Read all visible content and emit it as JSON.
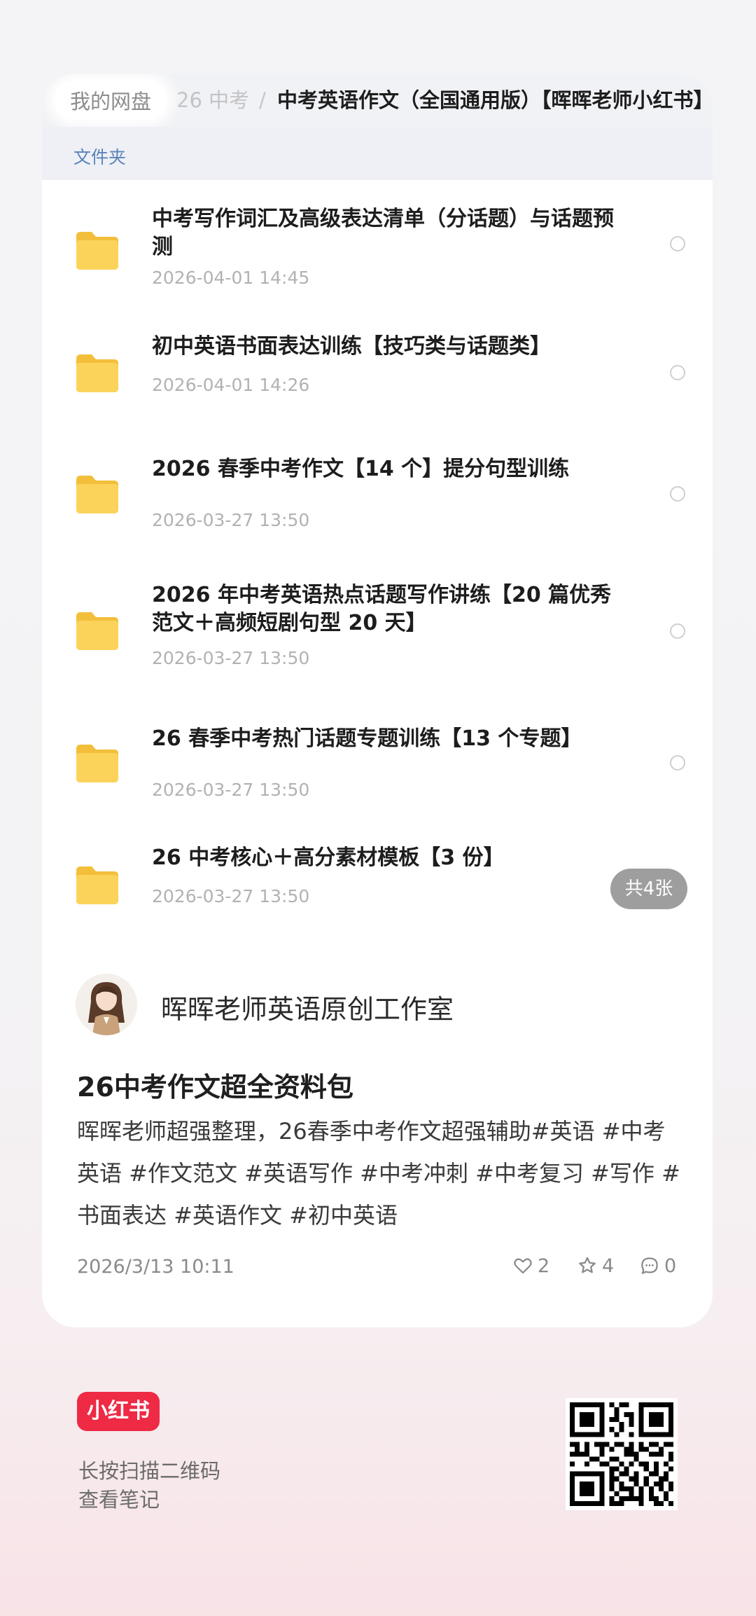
{
  "breadcrumb": {
    "root": "我的网盘",
    "level2": "26 中考",
    "separator": "/",
    "current": "中考英语作文（全国通用版）【晖晖老师小红书】"
  },
  "folder_header": "文件夹",
  "folders": [
    {
      "title": "中考写作词汇及高级表达清单（分话题）与话题预测",
      "date": "2026-04-01 14:45"
    },
    {
      "title": "初中英语书面表达训练【技巧类与话题类】",
      "date": "2026-04-01 14:26"
    },
    {
      "title": "2026 春季中考作文【14 个】提分句型训练",
      "date": "2026-03-27 13:50"
    },
    {
      "title": "2026 年中考英语热点话题写作讲练【20 篇优秀范文＋高频短剧句型 20 天】",
      "date": "2026-03-27 13:50"
    },
    {
      "title": "26 春季中考热门话题专题训练【13 个专题】",
      "date": "2026-03-27 13:50"
    },
    {
      "title": "26 中考核心＋高分素材模板【3 份】",
      "date": "2026-03-27 13:50"
    }
  ],
  "image_count": "共4张",
  "author": {
    "name": "晖晖老师英语原创工作室"
  },
  "post": {
    "title": "26中考作文超全资料包",
    "body": "晖晖老师超强整理，26春季中考作文超强辅助#英语 #中考英语 #作文范文 #英语写作 #中考冲刺 #中考复习 #写作 #书面表达 #英语作文 #初中英语",
    "date": "2026/3/13 10:11",
    "likes": "2",
    "stars": "4",
    "comments": "0"
  },
  "footer": {
    "brand": "小红书",
    "line1": "长按扫描二维码",
    "line2": "查看笔记"
  },
  "colors": {
    "accent_red": "#ee2a45",
    "folder_yellow": "#f7c948",
    "link_blue": "#5a84b8"
  },
  "icons": [
    "folder-icon",
    "radio-circle-icon",
    "heart-icon",
    "star-icon",
    "comment-icon",
    "qr-code-icon"
  ]
}
